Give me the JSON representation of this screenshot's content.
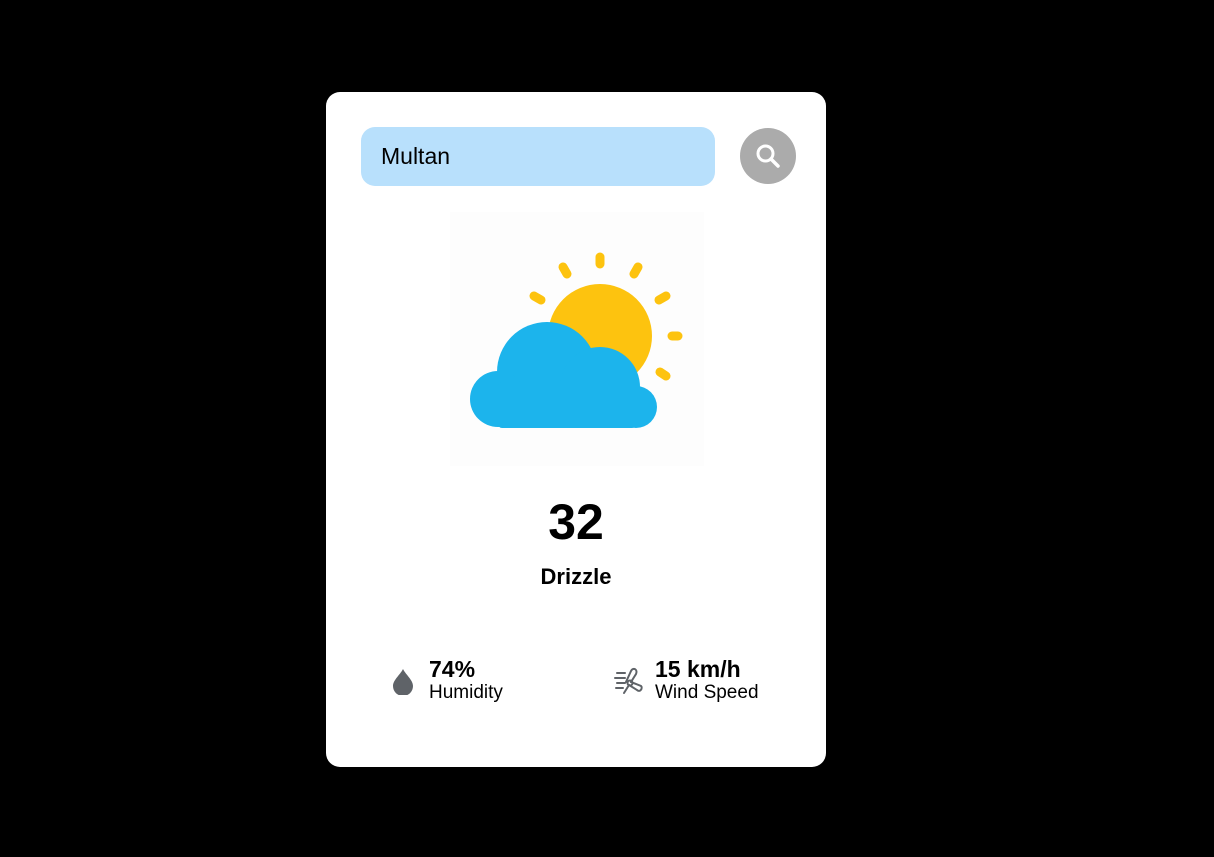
{
  "search": {
    "value": "Multan",
    "icon": "search-icon"
  },
  "weather": {
    "icon": "partly-cloudy-icon",
    "temperature": "32",
    "condition": "Drizzle"
  },
  "humidity": {
    "icon": "water-drop-icon",
    "value": "74%",
    "label": "Humidity"
  },
  "wind": {
    "icon": "wind-icon",
    "value": "15 km/h",
    "label": "Wind Speed"
  },
  "colors": {
    "background": "#000000",
    "card": "#ffffff",
    "search_field": "#b8e0fc",
    "search_button": "#ababab",
    "sun": "#fdc30f",
    "cloud": "#1cb4ec",
    "stat_icon": "#5f6368"
  }
}
